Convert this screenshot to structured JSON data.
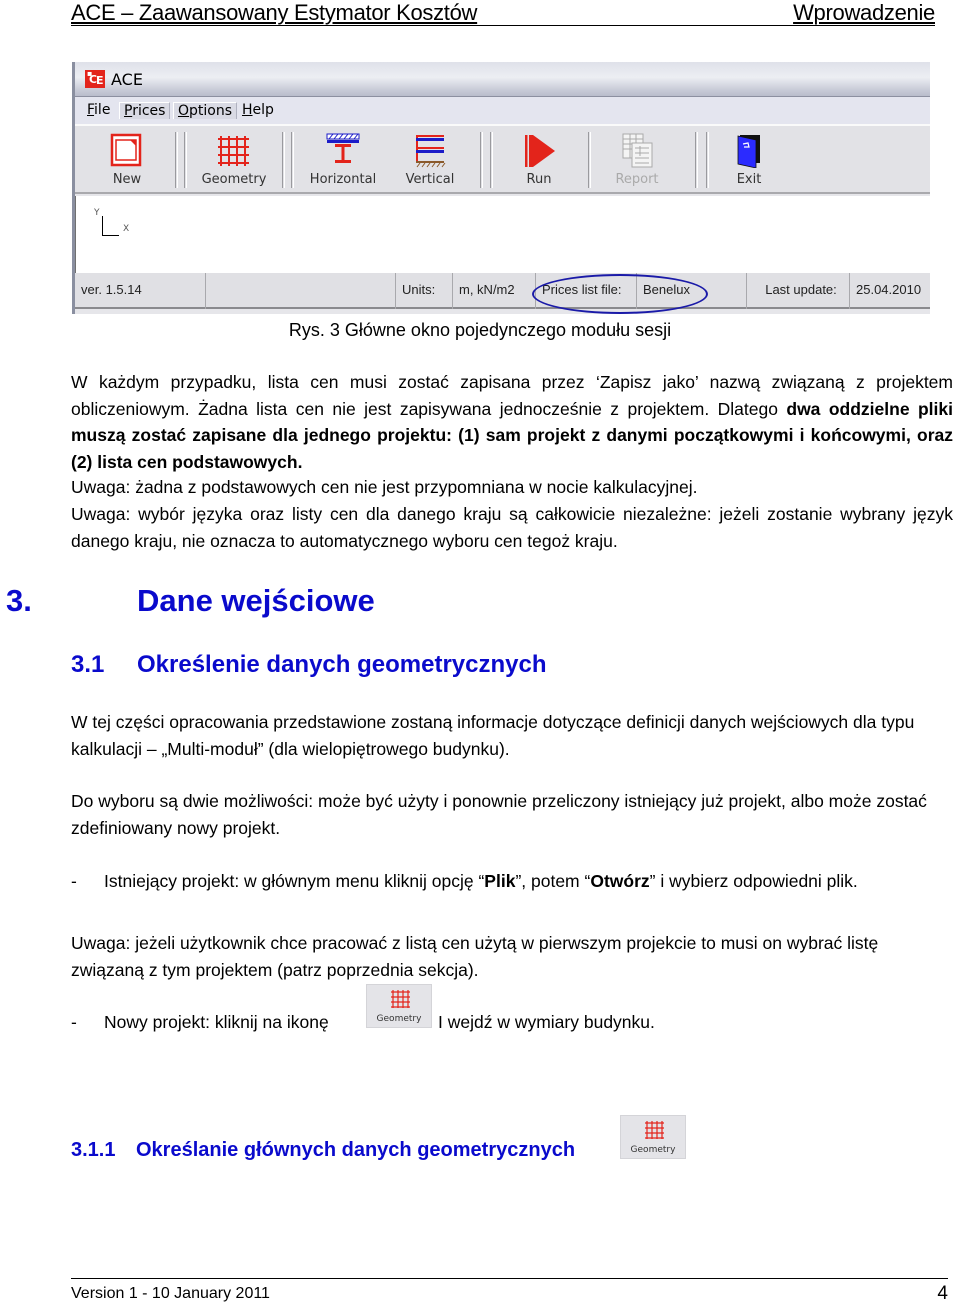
{
  "header": {
    "title": "ACE – Zaawansowany Estymator Kosztów",
    "section": "Wprowadzenie"
  },
  "app": {
    "title": "ACE",
    "logo_text": "ACE",
    "menu": [
      {
        "label": "File",
        "accel": "F"
      },
      {
        "label": "Prices",
        "accel": "P"
      },
      {
        "label": "Options",
        "accel": "O"
      },
      {
        "label": "Help",
        "accel": "H"
      }
    ],
    "toolbar": [
      {
        "label": "New",
        "icon": "new-document-icon",
        "enabled": true
      },
      {
        "label": "Geometry",
        "icon": "grid-icon",
        "enabled": true
      },
      {
        "label": "Horizontal",
        "icon": "horizontal-beam-icon",
        "enabled": true
      },
      {
        "label": "Vertical",
        "icon": "vertical-frame-icon",
        "enabled": true
      },
      {
        "label": "Run",
        "icon": "play-icon",
        "enabled": true
      },
      {
        "label": "Report",
        "icon": "report-icon",
        "enabled": false
      },
      {
        "label": "Exit",
        "icon": "exit-door-icon",
        "enabled": true
      }
    ],
    "axis": {
      "y": "Y",
      "x": "X"
    },
    "status": {
      "version": "ver. 1.5.14",
      "empty": "",
      "units_label": "Units:",
      "units_value": "m, kN/m2",
      "prices_label": "Prices list file:",
      "prices_value": "Benelux",
      "update_label": "Last update:",
      "update_value": "25.04.2010"
    },
    "colors": {
      "accent_red": "#e3241b",
      "highlight_ellipse": "#1a1aa8"
    }
  },
  "caption": "Rys. 3 Główne okno pojedynczego modułu sesji",
  "paragraphs": {
    "p1_normal": "W każdym przypadku, lista cen musi zostać zapisana przez ‘Zapisz jako’ nazwą związaną z projektem obliczeniowym. Żadna lista cen nie jest zapisywana jednocześnie z projektem. Dlatego ",
    "p1_bold": "dwa oddzielne pliki muszą zostać zapisane dla jednego projektu: (1) sam projekt z danymi początkowymi i końcowymi, oraz (2) lista cen podstawowych.",
    "note1": "Uwaga: żadna z podstawowych cen nie jest przypomniana w nocie kalkulacyjnej.",
    "note2": "Uwaga: wybór języka oraz listy cen dla danego kraju są całkowicie niezależne: jeżeli zostanie wybrany język danego kraju, nie oznacza to automatycznego wyboru cen tegoż kraju.",
    "intro": "W tej części opracowania przedstawione zostaną informacje dotyczące definicji danych wejściowych dla typu kalkulacji – „Multi-moduł” (dla wielopiętrowego budynku).",
    "options": "Do wyboru są dwie możliwości: może być użyty i ponownie przeliczony istniejący już projekt, albo może zostać zdefiniowany nowy projekt.",
    "note3": "Uwaga: jeżeli użytkownik chce pracować z listą cen użytą w pierwszym projekcie to musi on wybrać listę związaną z tym projektem (patrz poprzednia sekcja)."
  },
  "headings": {
    "h1_num": "3.",
    "h1_text": "Dane wejściowe",
    "h2_num": "3.1",
    "h2_text": "Określenie danych geometrycznych",
    "h3_num": "3.1.1",
    "h3_text": "Określanie głównych danych geometrycznych"
  },
  "bullets": {
    "dash": "-",
    "b1_a": "Istniejący projekt: w głównym menu kliknij opcję “",
    "b1_plik": "Plik",
    "b1_b": "”, potem “",
    "b1_otworz": "Otwórz",
    "b1_c": "” i wybierz odpowiedni plik.",
    "b2_a": "Nowy projekt: kliknij na ikonę",
    "b2_b": "I wejdź w wymiary budynku."
  },
  "inline_icon_label": "Geometry",
  "footer": {
    "version": "Version 1 - 10 January 2011",
    "page": "4"
  }
}
